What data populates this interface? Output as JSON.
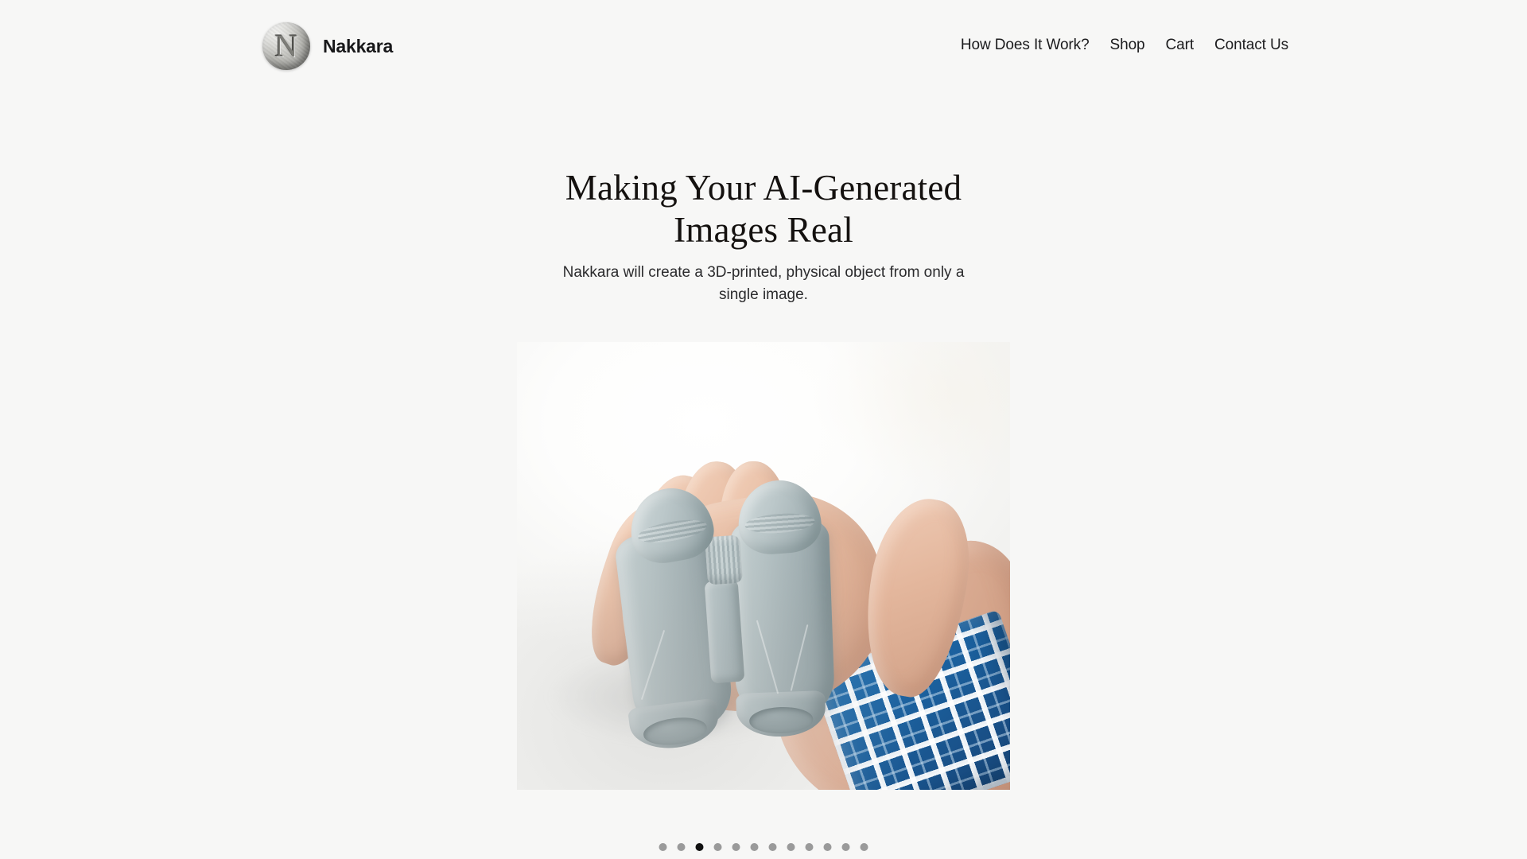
{
  "theme": {
    "background": "#f7f7f6",
    "text": "#1a1a1a",
    "dot_inactive": "#9a9a9a",
    "dot_active": "#111111"
  },
  "header": {
    "brand": {
      "logo_icon": "nakkara-disc-logo-icon",
      "logo_letter": "N",
      "name": "Nakkara"
    },
    "nav": [
      {
        "label": "How Does It Work?"
      },
      {
        "label": "Shop"
      },
      {
        "label": "Cart"
      },
      {
        "label": "Contact Us"
      }
    ]
  },
  "hero": {
    "title": "Making Your AI-Generated Images Real",
    "subtitle": "Nakkara will create a 3D-printed, physical object from only a single image.",
    "image": {
      "alt": "A hand holding a small gray 3D-printed pair of binoculars, wearing a blue and white plaid shirt cuff",
      "subject": "3D-printed binoculars held in an open palm",
      "background": "white",
      "object_color": "#a9b7ba",
      "cuff_color": "#1b5f9c"
    }
  },
  "carousel": {
    "total_slides": 12,
    "active_index": 3,
    "dots": [
      {
        "index": 1,
        "active": false
      },
      {
        "index": 2,
        "active": false
      },
      {
        "index": 3,
        "active": true
      },
      {
        "index": 4,
        "active": false
      },
      {
        "index": 5,
        "active": false
      },
      {
        "index": 6,
        "active": false
      },
      {
        "index": 7,
        "active": false
      },
      {
        "index": 8,
        "active": false
      },
      {
        "index": 9,
        "active": false
      },
      {
        "index": 10,
        "active": false
      },
      {
        "index": 11,
        "active": false
      },
      {
        "index": 12,
        "active": false
      }
    ]
  }
}
